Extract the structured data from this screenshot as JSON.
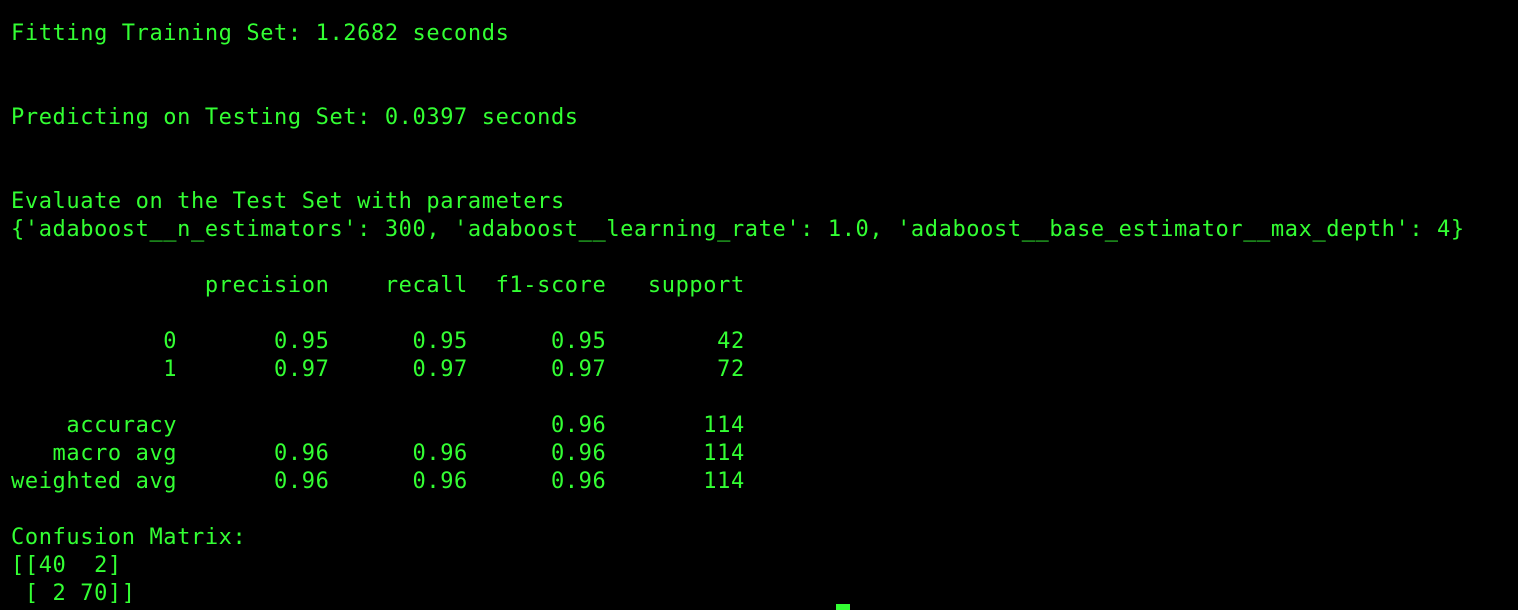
{
  "colors": {
    "background": "#000000",
    "text": "#33ff33"
  },
  "terminal": {
    "lines": [
      "Fitting Training Set: 1.2682 seconds",
      "",
      "",
      "Predicting on Testing Set: 0.0397 seconds",
      "",
      "",
      "Evaluate on the Test Set with parameters",
      "{'adaboost__n_estimators': 300, 'adaboost__learning_rate': 1.0, 'adaboost__base_estimator__max_depth': 4}",
      "",
      "              precision    recall  f1-score   support",
      "",
      "           0       0.95      0.95      0.95        42",
      "           1       0.97      0.97      0.97        72",
      "",
      "    accuracy                           0.96       114",
      "   macro avg       0.96      0.96      0.96       114",
      "weighted avg       0.96      0.96      0.96       114",
      "",
      "Confusion Matrix:",
      "[[40  2]",
      " [ 2 70]]"
    ]
  }
}
